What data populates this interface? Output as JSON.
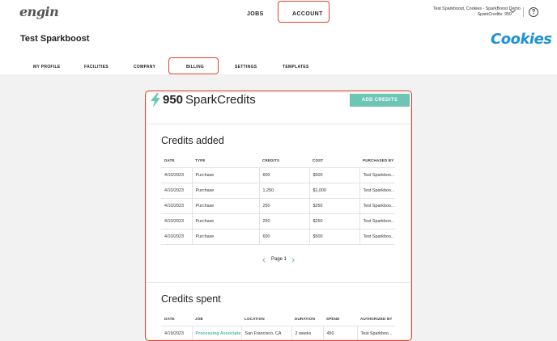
{
  "topnav": {
    "logo": "engin",
    "jobs_label": "JOBS",
    "account_label": "ACCOUNT",
    "user_name": "Test Sparkboost, Cookies - SparkBoost Demo",
    "user_credits": "SparkCredits: 950",
    "help_glyph": "?"
  },
  "org": {
    "title": "Test Sparkboost",
    "brand": "Cookies"
  },
  "tabs": [
    "MY PROFILE",
    "FACILITIES",
    "COMPANY",
    "BILLING",
    "SETTINGS",
    "TEMPLATES"
  ],
  "billing": {
    "credits_count": "950",
    "credits_unit": "SparkCredits",
    "add_button": "ADD CREDITS",
    "credits_added": {
      "title": "Credits added",
      "columns": [
        "DATE",
        "TYPE",
        "CREDITS",
        "COST",
        "PURCHASED BY"
      ],
      "rows": [
        [
          "4/10/2023",
          "Purchase",
          "600",
          "$500",
          "Test Sparkboo..."
        ],
        [
          "4/10/2023",
          "Purchase",
          "1,250",
          "$1,000",
          "Test Sparkboo..."
        ],
        [
          "4/10/2023",
          "Purchase",
          "250",
          "$250",
          "Test Sparkboo..."
        ],
        [
          "4/10/2023",
          "Purchase",
          "250",
          "$250",
          "Test Sparkboo..."
        ],
        [
          "4/10/2023",
          "Purchase",
          "600",
          "$500",
          "Test Sparkboo..."
        ]
      ],
      "page_label": "Page 1"
    },
    "credits_spent": {
      "title": "Credits spent",
      "columns": [
        "DATE",
        "JOB",
        "LOCATION",
        "DURATION",
        "SPEND",
        "AUTHORIZED BY"
      ],
      "rows": [
        [
          "4/19/2023",
          "Processing Associate",
          "San Francisco, CA",
          "2 weeks",
          "450",
          "Test Sparkboo..."
        ]
      ]
    }
  },
  "colors": {
    "accent": "#6dc5b6",
    "highlight": "#e2432a",
    "brand_blue": "#1e90d6"
  }
}
